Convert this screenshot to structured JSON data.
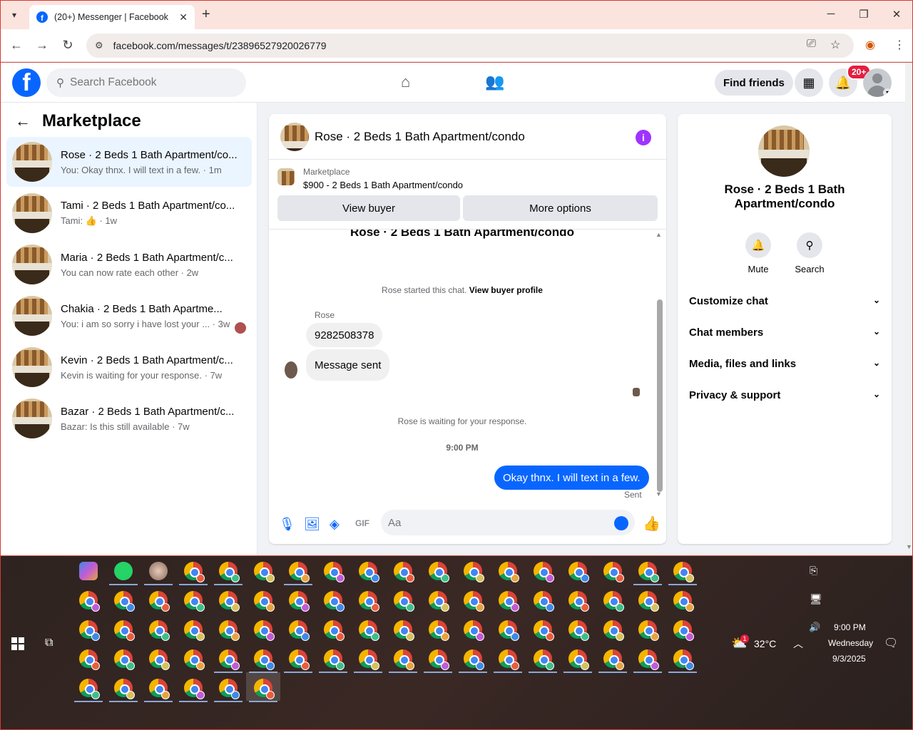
{
  "browser": {
    "tab_title": "(20+) Messenger | Facebook",
    "url": "facebook.com/messages/t/23896527920026779"
  },
  "fbnav": {
    "search_placeholder": "Search Facebook",
    "find_friends": "Find friends",
    "notif_badge": "20+"
  },
  "left": {
    "title": "Marketplace",
    "conversations": [
      {
        "name": "Rose · 2 Beds 1 Bath Apartment/co...",
        "sub": "You: Okay thnx. I will text in a few. · 1m"
      },
      {
        "name": "Tami · 2 Beds 1 Bath Apartment/co...",
        "sub": "Tami: 👍 · 1w"
      },
      {
        "name": "Maria · 2 Beds 1 Bath Apartment/c...",
        "sub": "You can now rate each other · 2w"
      },
      {
        "name": "Chakia · 2 Beds 1 Bath Apartme...",
        "sub": "You: i am so sorry i have lost your ... · 3w"
      },
      {
        "name": "Kevin · 2 Beds 1 Bath Apartment/c...",
        "sub": "Kevin is waiting for your response. · 7w"
      },
      {
        "name": "Bazar · 2 Beds 1 Bath Apartment/c...",
        "sub": "Bazar: Is this still available · 7w"
      }
    ]
  },
  "chat": {
    "header_name": "Rose · 2 Beds 1 Bath Apartment/condo",
    "listing_label": "Marketplace",
    "listing_price": "$900 - 2 Beds 1 Bath Apartment/condo",
    "btn_view_buyer": "View buyer",
    "btn_more_options": "More options",
    "body_title": "Rose · 2 Beds 1 Bath Apartment/condo",
    "started_text": "Rose started this chat.",
    "view_buyer_profile": "View buyer profile",
    "sender": "Rose",
    "msg1": "9282508378",
    "msg2": "Message sent",
    "waiting": "Rose is waiting for your response.",
    "time": "9:00 PM",
    "out_msg": "Okay thnx. I will text in a few.",
    "sent": "Sent",
    "input_placeholder": "Aa"
  },
  "right": {
    "name": "Rose · 2 Beds 1 Bath Apartment/condo",
    "mute": "Mute",
    "search": "Search",
    "sections": [
      "Customize chat",
      "Chat members",
      "Media, files and links",
      "Privacy & support"
    ]
  },
  "taskbar": {
    "weather_temp": "32°C",
    "weather_badge": "1",
    "time": "9:00 PM",
    "day": "Wednesday",
    "date": "9/3/2025"
  }
}
